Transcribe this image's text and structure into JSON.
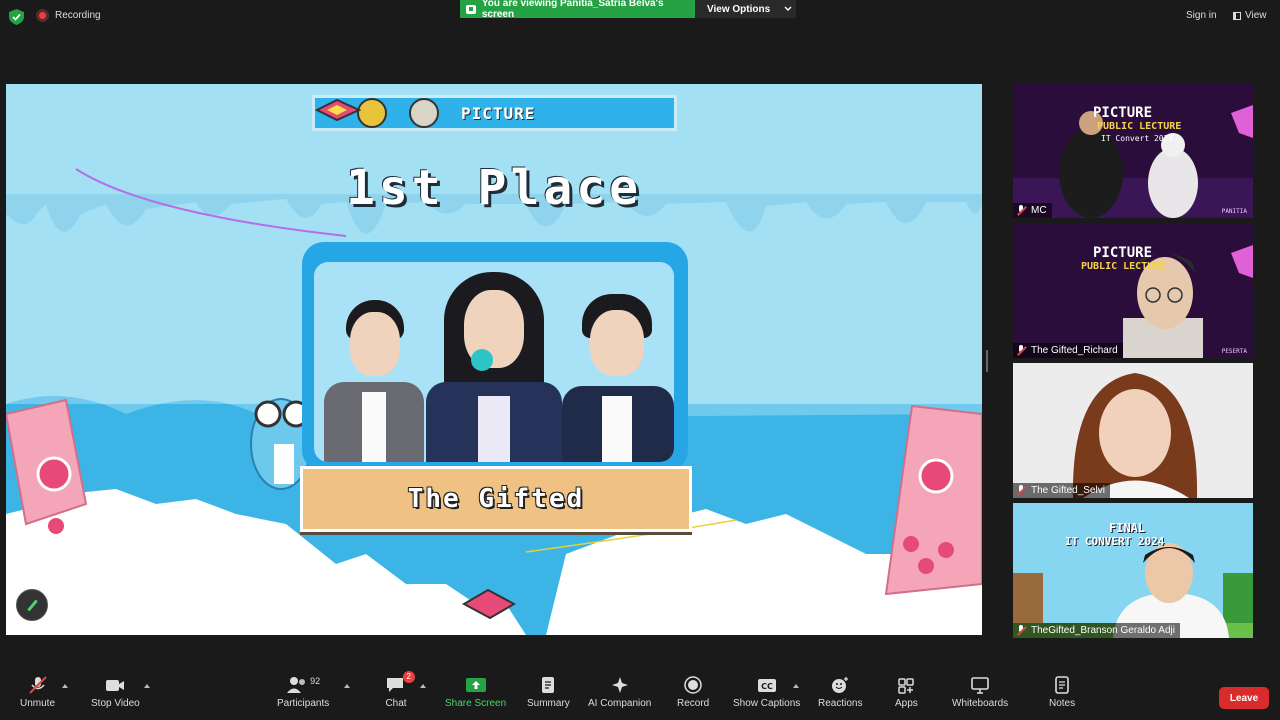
{
  "topbar": {
    "recording_label": "Recording",
    "viewing_banner": "You are viewing Panitia_Satria Belva's screen",
    "view_options": "View Options",
    "sign_in": "Sign in",
    "view": "View"
  },
  "slide": {
    "banner_title": "PICTURE",
    "place_title": "1st Place",
    "team_name": "The Gifted"
  },
  "gallery": [
    {
      "name": "MC",
      "pixel_lines": [
        "PICTURE",
        "PUBLIC LECTURE",
        "IT Convert 2024"
      ],
      "corner": "PANITIA"
    },
    {
      "name": "The Gifted_Richard",
      "pixel_lines": [
        "PICTURE",
        "PUBLIC LECTURE"
      ],
      "corner": "PESERTA"
    },
    {
      "name": "The Gifted_Selvi"
    },
    {
      "name": "TheGifted_Branson Geraldo Adji",
      "pixel_lines": [
        "FINAL",
        "IT CONVERT 2024"
      ]
    }
  ],
  "toolbar": {
    "unmute": "Unmute",
    "stop_video": "Stop Video",
    "participants": "Participants",
    "participants_count": "92",
    "chat": "Chat",
    "chat_badge": "2",
    "share_screen": "Share Screen",
    "summary": "Summary",
    "ai_companion": "AI Companion",
    "record": "Record",
    "show_captions": "Show Captions",
    "reactions": "Reactions",
    "apps": "Apps",
    "whiteboards": "Whiteboards",
    "notes": "Notes",
    "leave": "Leave"
  },
  "colors": {
    "share_green": "#25a244",
    "leave_red": "#d92b2b",
    "slide_sky": "#a4e0f3",
    "frame_blue": "#26a6e5",
    "plate_tan": "#efc283"
  }
}
